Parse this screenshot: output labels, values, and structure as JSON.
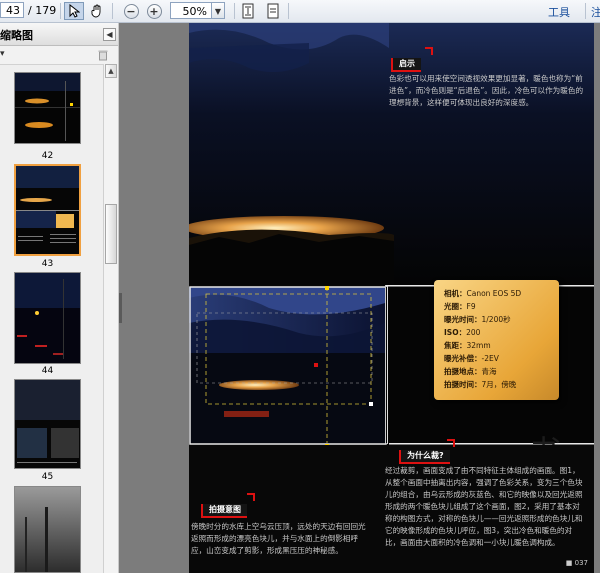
{
  "toolbar": {
    "current_page": "43",
    "total_pages": "/ 179",
    "zoom_value": "50%",
    "menu_tools": "工具",
    "menu_partial": "注"
  },
  "sidebar": {
    "title": "缩略图",
    "thumbnails": [
      {
        "page": "42"
      },
      {
        "page": "43"
      },
      {
        "page": "44"
      },
      {
        "page": "45"
      },
      {
        "page": ""
      }
    ]
  },
  "document_page": {
    "section_tip": {
      "tag": "启示",
      "text": "色彩也可以用来使空间透视效果更加显著，暖色也称为“前进色”，而冷色则是“后退色”。因此，冷色可以作为暖色的理想背景，这样便可体现出良好的深度感。"
    },
    "exif": [
      {
        "label": "相机：",
        "value": "Canon EOS 5D"
      },
      {
        "label": "光圈：",
        "value": "F9"
      },
      {
        "label": "曝光时间：",
        "value": "1/200秒"
      },
      {
        "label": "ISO：",
        "value": "200"
      },
      {
        "label": "焦距：",
        "value": "32mm"
      },
      {
        "label": "曝光补偿：",
        "value": "-2EV"
      },
      {
        "label": "拍摄地点：",
        "value": "青海"
      },
      {
        "label": "拍摄时间：",
        "value": "7月，傍晚"
      }
    ],
    "section_why": {
      "tag": "为什么裁?",
      "text": "经过裁剪，画面变成了由不同特征主体组成的画面。图1，从整个画面中抽离出内容，强调了色彩关系，变为三个色块儿的组合，由乌云形成的灰蓝色、和它的映像以及回光返照形成的两个暖色块儿组成了这个画面，图2，采用了基本对称的构图方式，对称的色块儿——回光返照形成的色块儿和它的映像形成的色块儿呼应，图3，突出冷色和暖色的对比，画面由大面积的冷色调和一小块儿暖色调构成。"
    },
    "section_shoot": {
      "tag": "拍摄意图",
      "text": "傍晚时分的水库上空乌云压顶，远处的天边有回回光返照而形成的漂亮色块儿，并与水面上的倒影相呼应，山峦变成了剪影，形成黑压压的神秘感。"
    },
    "page_number": "037"
  },
  "colors": {
    "accent_red": "#d11111",
    "info_card": "#f0b850",
    "page_bg": "#070707",
    "viewer_bg": "#7c7c7c"
  }
}
